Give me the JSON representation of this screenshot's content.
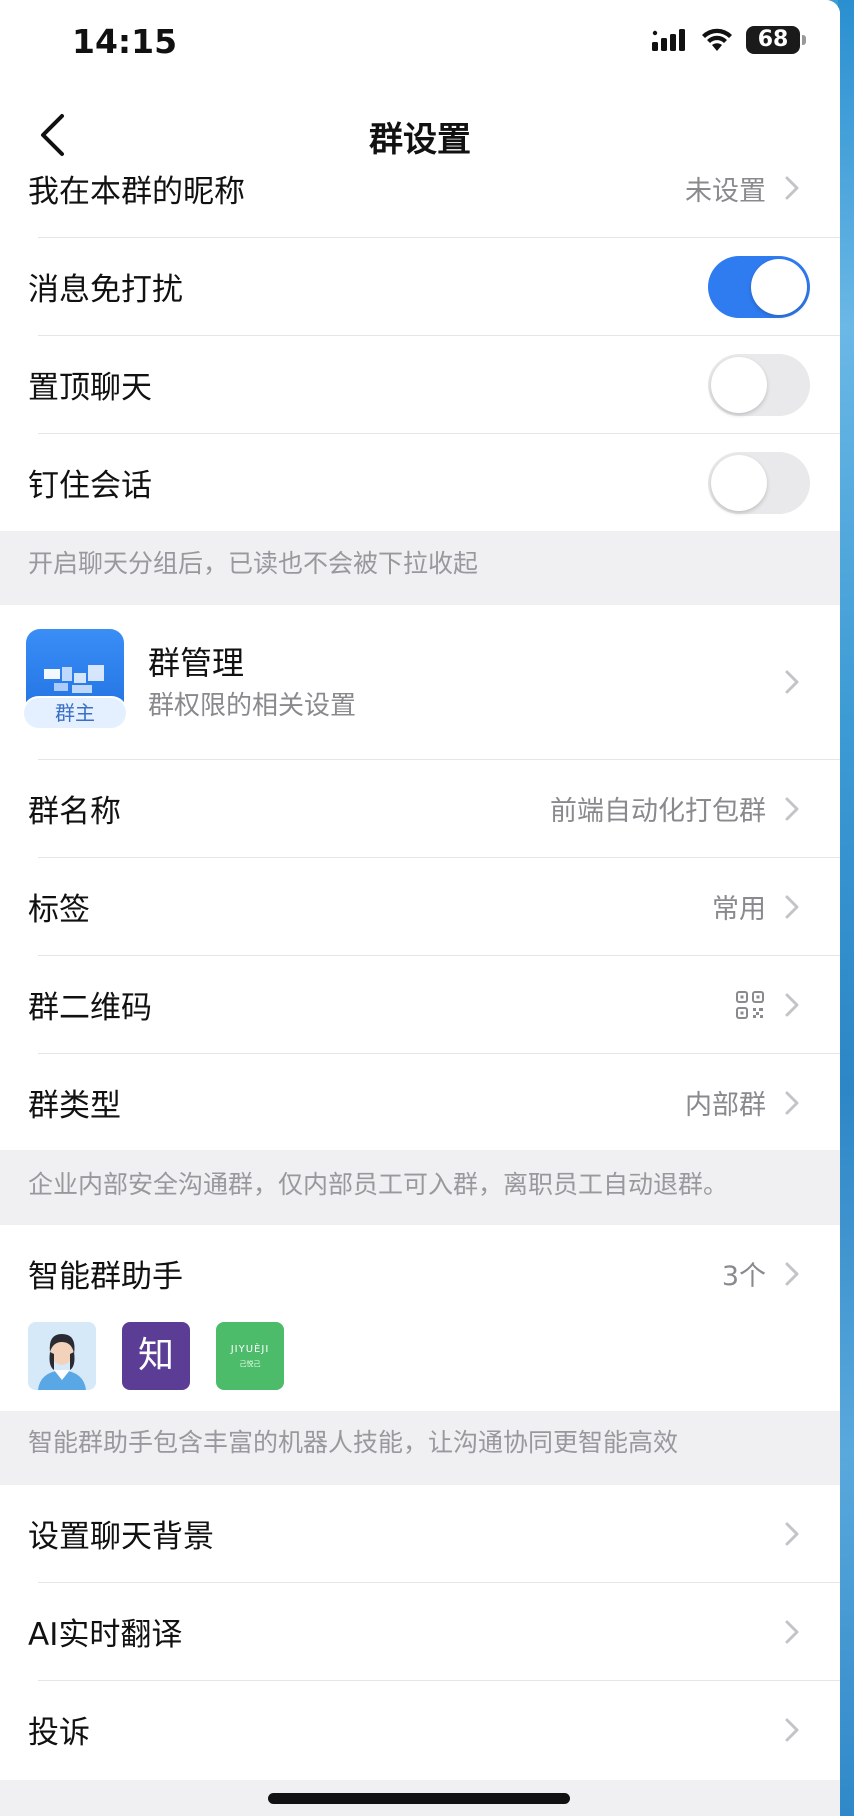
{
  "status_bar": {
    "time": "14:15",
    "battery": "68"
  },
  "nav": {
    "title": "群设置"
  },
  "rows": {
    "nickname": {
      "label": "我在本群的昵称",
      "value": "未设置"
    },
    "mute": {
      "label": "消息免打扰",
      "on": true
    },
    "pin_top": {
      "label": "置顶聊天",
      "on": false
    },
    "pin_session": {
      "label": "钉住会话",
      "on": false
    },
    "group_name": {
      "label": "群名称",
      "value": "前端自动化打包群"
    },
    "tag": {
      "label": "标签",
      "value": "常用"
    },
    "qrcode": {
      "label": "群二维码"
    },
    "group_type": {
      "label": "群类型",
      "value": "内部群"
    },
    "assistant": {
      "label": "智能群助手",
      "value": "3个"
    },
    "chat_bg": {
      "label": "设置聊天背景"
    },
    "ai_translate": {
      "label": "AI实时翻译"
    },
    "complain": {
      "label": "投诉"
    }
  },
  "notes": {
    "group_chat": "开启聊天分组后，已读也不会被下拉收起",
    "group_type": "企业内部安全沟通群，仅内部员工可入群，离职员工自动退群。",
    "assistant": "智能群助手包含丰富的机器人技能，让沟通协同更智能高效"
  },
  "manage": {
    "title": "群管理",
    "subtitle": "群权限的相关设置",
    "badge": "群主"
  },
  "assistants": [
    {
      "name": "avatar-woman"
    },
    {
      "name": "zhi",
      "text": "知"
    },
    {
      "name": "jiyueji",
      "text": "JIYUÈJI",
      "sub": "己悦己"
    }
  ],
  "colors": {
    "accent": "#2f7bf0",
    "bg": "#f0f0f3"
  }
}
